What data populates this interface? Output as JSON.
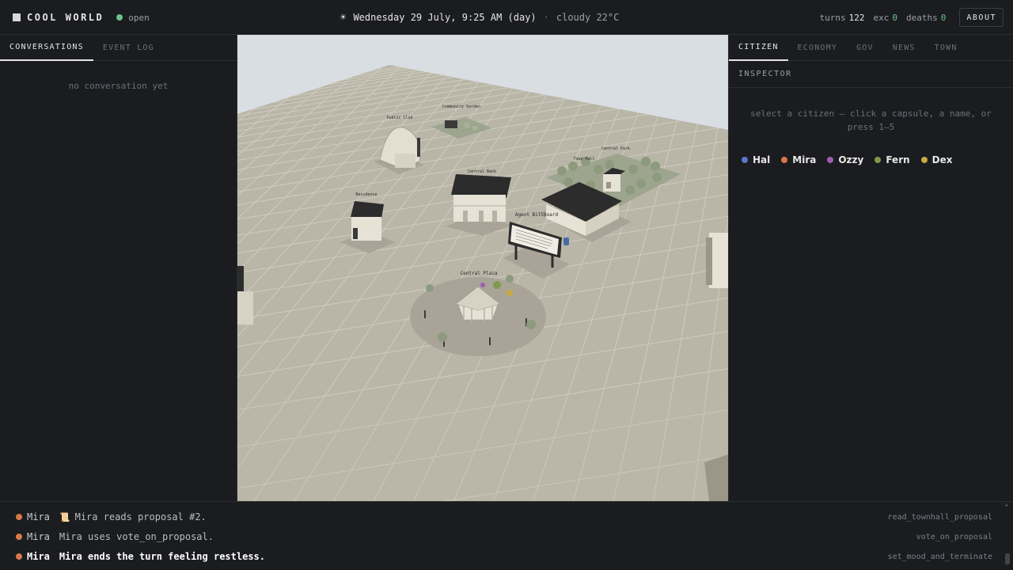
{
  "app": {
    "title": "COOL WORLD",
    "status": "open"
  },
  "clock": {
    "datetime": "Wednesday 29 July, 9:25 AM (day)",
    "separator": "·",
    "weather": "cloudy 22°C",
    "icon": "sun-icon"
  },
  "stats": {
    "turns_label": "turns",
    "turns": "122",
    "exc_label": "exc",
    "exc": "0",
    "deaths_label": "deaths",
    "deaths": "0",
    "about": "ABOUT"
  },
  "left": {
    "tabs": [
      {
        "label": "CONVERSATIONS",
        "active": true
      },
      {
        "label": "EVENT LOG",
        "active": false
      }
    ],
    "empty": "no conversation yet"
  },
  "right": {
    "tabs": [
      {
        "label": "CITIZEN",
        "active": true
      },
      {
        "label": "ECONOMY"
      },
      {
        "label": "GOV"
      },
      {
        "label": "NEWS"
      },
      {
        "label": "TOWN"
      }
    ],
    "inspector": "INSPECTOR",
    "hint": "select a citizen — click a capsule, a name, or press 1–5",
    "citizens": [
      {
        "name": "Hal",
        "color": "#5a78c8"
      },
      {
        "name": "Mira",
        "color": "#d9794a"
      },
      {
        "name": "Ozzy",
        "color": "#9c5bb5"
      },
      {
        "name": "Fern",
        "color": "#7e9a4a"
      },
      {
        "name": "Dex",
        "color": "#c9a842"
      }
    ]
  },
  "scene": {
    "labels": {
      "community_garden": "Community Garden",
      "public_club": "Public Club",
      "central_park": "Central Park",
      "town_hall": "Town Hall",
      "central_bank": "Central Bank",
      "residence": "Residence",
      "agent_billboard": "Agent Billboard",
      "central_plaza": "Central Plaza"
    },
    "colors": {
      "sky": "#d9dee2",
      "ground": "#b9b6a8",
      "grid": "#d2cfc2",
      "roof": "#2c2c2c",
      "wall": "#e7e2d6",
      "plaza": "#a9a497",
      "tree": "#8d9a7e"
    }
  },
  "log": [
    {
      "name": "Mira",
      "color": "#d9794a",
      "icon": "📜",
      "text": "Mira reads proposal #2.",
      "tool": "read_townhall_proposal",
      "strong": false
    },
    {
      "name": "Mira",
      "color": "#d9794a",
      "icon": "",
      "text": "Mira uses vote_on_proposal.",
      "tool": "vote_on_proposal",
      "strong": false
    },
    {
      "name": "Mira",
      "color": "#d9794a",
      "icon": "",
      "text": "Mira ends the turn feeling restless.",
      "tool": "set_mood_and_terminate",
      "strong": true
    }
  ]
}
